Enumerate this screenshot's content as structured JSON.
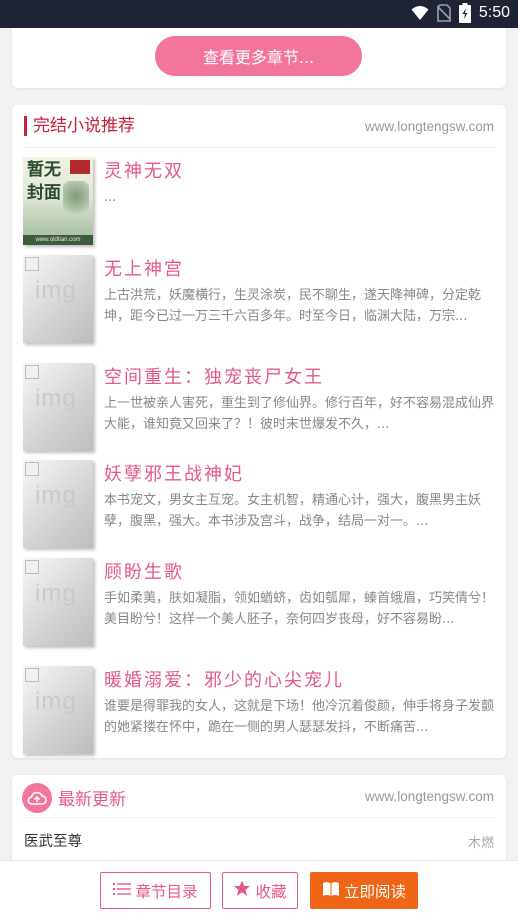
{
  "status_bar": {
    "time": "5:50"
  },
  "top_card": {
    "more_chapters_label": "查看更多章节..."
  },
  "recommend": {
    "title": "完结小说推荐",
    "site": "www.longtengsw.com",
    "cover_placeholder": "img",
    "first_cover": {
      "text": "暂无封面",
      "url": "www.oldtian.com"
    },
    "books": [
      {
        "title": "灵神无双",
        "desc": "..."
      },
      {
        "title": "无上神宫",
        "desc": "上古洪荒，妖魔横行，生灵涂炭，民不聊生，遂天降神碑，分定乾坤，距今已过一万三千六百多年。时至今日，临渊大陆，万宗..."
      },
      {
        "title": "空间重生：独宠丧尸女王",
        "desc": "上一世被亲人害死，重生到了修仙界。修行百年，好不容易混成仙界大能，谁知竟又回来了？！彼时末世爆发不久，..."
      },
      {
        "title": "妖孽邪王战神妃",
        "desc": "本书宠文，男女主互宠。女主机智，精通心计，强大，腹黑男主妖孽，腹黑，强大。本书涉及宫斗，战争，结局一对一。..."
      },
      {
        "title": "顾盼生歌",
        "desc": "手如柔荑，肤如凝脂，领如蝤蛴，齿如瓠犀，螓首蛾眉，巧笑倩兮！美目盼兮！这样一个美人胚子，奈何四岁丧母，好不容易盼..."
      },
      {
        "title": "暖婚溺爱：邪少的心尖宠儿",
        "desc": "谁要是得罪我的女人，这就是下场！他冷沉着俊颜，伸手将身子发颤的她紧搂在怀中，跪在一侧的男人瑟瑟发抖，不断痛苦..."
      }
    ]
  },
  "latest": {
    "title": "最新更新",
    "site": "www.longtengsw.com",
    "items": [
      {
        "book": "医武至尊",
        "author": "木燃"
      }
    ]
  },
  "bottom_bar": {
    "toc_label": "章节目录",
    "favorite_label": "收藏",
    "read_label": "立即阅读"
  },
  "colors": {
    "accent_pink": "#e5588a",
    "button_pink": "#f2769c",
    "read_orange": "#ee6515",
    "section_red": "#c8203a",
    "status_bar": "#1f2434"
  }
}
